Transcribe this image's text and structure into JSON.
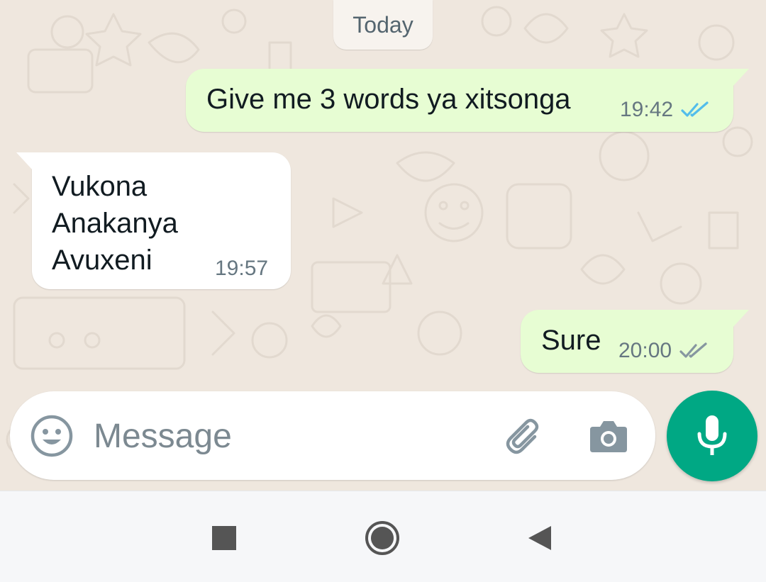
{
  "chat": {
    "date_chip": "Today",
    "messages": [
      {
        "direction": "out",
        "text": "Give me 3 words ya xitsonga",
        "time": "19:42",
        "status": "read",
        "tick_color": "#53bdeb"
      },
      {
        "direction": "in",
        "text": "Vukona\nAnakanya\nAvuxeni",
        "time": "19:57"
      },
      {
        "direction": "out",
        "text": "Sure",
        "time": "20:00",
        "status": "delivered",
        "tick_color": "#8696a0"
      }
    ]
  },
  "composer": {
    "placeholder": "Message",
    "value": "",
    "icons": [
      "emoji-icon",
      "paperclip-icon",
      "camera-icon",
      "microphone-icon"
    ]
  },
  "navigation": {
    "buttons": [
      "recent-apps",
      "home",
      "back"
    ]
  },
  "colors": {
    "wallpaper": "#efe7de",
    "outgoing_bubble": "#e7fdd3",
    "incoming_bubble": "#ffffff",
    "accent": "#00a884",
    "icon_gray": "#8696a0"
  }
}
